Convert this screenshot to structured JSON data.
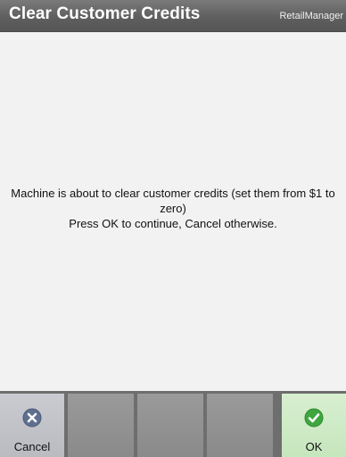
{
  "window": {
    "title": "Clear Customer Credits",
    "brand": "RetailManager"
  },
  "message": {
    "line1": "Machine is about to clear customer credits (set them from $1 to zero)",
    "line2": "Press OK to continue, Cancel otherwise."
  },
  "toolbar": {
    "cancel_label": "Cancel",
    "cancel_icon": "x-circle-icon",
    "ok_label": "OK",
    "ok_icon": "checkmark-circle-icon"
  },
  "colors": {
    "titlebar": "#666666",
    "cancel_icon": "#5f6f8f",
    "ok_icon": "#3fa63f",
    "ok_button": "#cfeac6"
  }
}
